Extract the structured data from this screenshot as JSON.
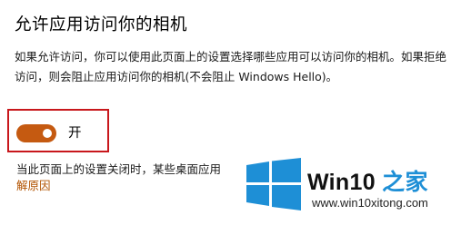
{
  "section": {
    "title": "允许应用访问你的相机",
    "description": "如果允许访问，你可以使用此页面上的设置选择哪些应用可以访问你的相机。如果拒绝访问，则会阻止应用访问你的相机(不会阻止 Windows Hello)。"
  },
  "toggle": {
    "state": "on",
    "label": "开",
    "accent_color": "#c55a11"
  },
  "note": {
    "text": "当此页面上的设置关闭时，某些桌面应用",
    "link_text": "解原因"
  },
  "watermark": {
    "brand_main": "Win10 ",
    "brand_accent": "之家",
    "url": "www.win10xitong.com",
    "logo_icon": "windows-logo-icon",
    "logo_color": "#1e8fd6"
  },
  "annotation": {
    "box_color": "#c8171c"
  }
}
